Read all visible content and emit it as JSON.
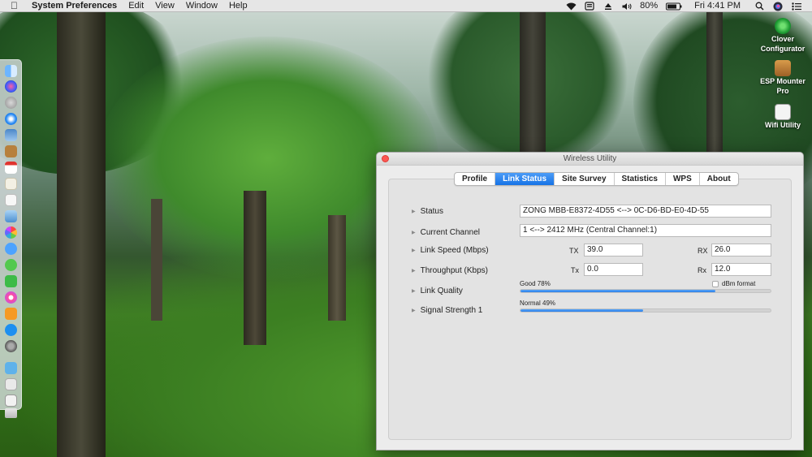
{
  "menubar": {
    "app_name": "System Preferences",
    "menus": [
      "Edit",
      "View",
      "Window",
      "Help"
    ],
    "status": {
      "battery": "80%",
      "clock": "Fri 4:41 PM"
    },
    "icons": [
      "apple-icon",
      "wifi-icon",
      "script-icon",
      "eject-icon",
      "volume-icon",
      "battery-icon",
      "search-icon",
      "siri-icon",
      "notification-center-icon"
    ]
  },
  "desktop_icons": [
    {
      "label": "Clover Configurator",
      "icon": "clover-configurator-icon"
    },
    {
      "label": "ESP Mounter Pro",
      "icon": "esp-mounter-icon"
    },
    {
      "label": "Wifi Utility",
      "icon": "wifi-utility-icon"
    }
  ],
  "dock": {
    "items": [
      "finder",
      "siri",
      "launchpad",
      "safari",
      "preview",
      "notes-book",
      "calendar",
      "textedit",
      "photos-viewer",
      "photos",
      "messages-blue",
      "messages",
      "facetime",
      "itunes",
      "ibooks",
      "app-store",
      "system-preferences",
      "folder",
      "downloads",
      "document",
      "trash"
    ]
  },
  "window": {
    "title": "Wireless Utility",
    "tabs": [
      {
        "label": "Profile",
        "active": false
      },
      {
        "label": "Link Status",
        "active": true
      },
      {
        "label": "Site Survey",
        "active": false
      },
      {
        "label": "Statistics",
        "active": false
      },
      {
        "label": "WPS",
        "active": false
      },
      {
        "label": "About",
        "active": false
      }
    ],
    "link_status": {
      "status": {
        "label": "Status",
        "value": "ZONG MBB-E8372-4D55 <--> 0C-D6-BD-E0-4D-55"
      },
      "channel": {
        "label": "Current Channel",
        "value": "1 <--> 2412 MHz (Central Channel:1)"
      },
      "link_speed": {
        "label": "Link Speed (Mbps)",
        "tx_label": "TX",
        "tx": "39.0",
        "rx_label": "RX",
        "rx": "26.0"
      },
      "throughput": {
        "label": "Throughput (Kbps)",
        "tx_label": "Tx",
        "tx": "0.0",
        "rx_label": "Rx",
        "rx": "12.0"
      },
      "link_quality": {
        "label": "Link Quality",
        "caption": "Good 78%",
        "percent": 78,
        "dbm_label": "dBm format",
        "dbm_checked": false
      },
      "signal_strength": {
        "label": "Signal Strength 1",
        "caption": "Normal 49%",
        "percent": 49
      }
    }
  },
  "colors": {
    "accent": "#1673e6",
    "bar_fill": "#2a7fe9",
    "close_button": "#fc5753"
  }
}
